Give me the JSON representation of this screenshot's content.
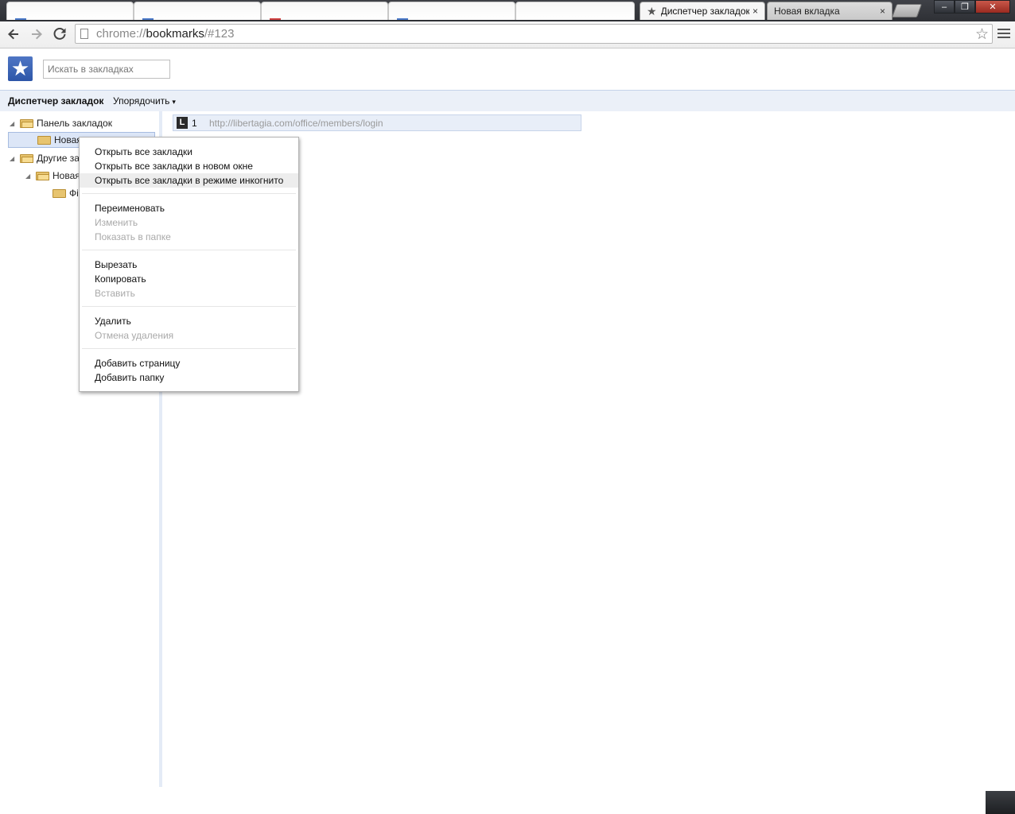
{
  "tabs": [
    {
      "title": "",
      "stripe": "#4a78c8"
    },
    {
      "title": "",
      "stripe": "#4a78c8"
    },
    {
      "title": "",
      "stripe": "#d04040"
    },
    {
      "title": "",
      "stripe": "#4a78c8"
    },
    {
      "title": "",
      "stripe": ""
    },
    {
      "title": "Диспетчер закладок",
      "close": "×"
    },
    {
      "title": "Новая вкладка",
      "close": "×"
    }
  ],
  "window_controls": {
    "minimize": "–",
    "maximize": "❐",
    "close": "✕"
  },
  "omnibox": {
    "scheme": "chrome://",
    "host": "bookmarks",
    "path": "/#123"
  },
  "search": {
    "placeholder": "Искать в закладках"
  },
  "header": {
    "title": "Диспетчер закладок",
    "organize": "Упорядочить",
    "caret": "▾"
  },
  "tree": [
    {
      "label": "Панель закладок",
      "expanded": true
    },
    {
      "label": "Новая",
      "selected": true
    },
    {
      "label": "Другие за",
      "expanded": true
    },
    {
      "label": "Новая",
      "expanded": true
    },
    {
      "label": "Фі"
    }
  ],
  "bookmarks": [
    {
      "favicon": "L",
      "name": "1",
      "url": "http://libertagia.com/office/members/login"
    }
  ],
  "context_menu": {
    "groups": [
      [
        {
          "label": "Открыть все закладки",
          "enabled": true
        },
        {
          "label": "Открыть все закладки в новом окне",
          "enabled": true
        },
        {
          "label": "Открыть все закладки в режиме инкогнито",
          "enabled": true,
          "hover": true
        }
      ],
      [
        {
          "label": "Переименовать",
          "enabled": true
        },
        {
          "label": "Изменить",
          "enabled": false
        },
        {
          "label": "Показать в папке",
          "enabled": false
        }
      ],
      [
        {
          "label": "Вырезать",
          "enabled": true
        },
        {
          "label": "Копировать",
          "enabled": true
        },
        {
          "label": "Вставить",
          "enabled": false
        }
      ],
      [
        {
          "label": "Удалить",
          "enabled": true
        },
        {
          "label": "Отмена удаления",
          "enabled": false
        }
      ],
      [
        {
          "label": "Добавить страницу",
          "enabled": true
        },
        {
          "label": "Добавить папку",
          "enabled": true
        }
      ]
    ]
  }
}
